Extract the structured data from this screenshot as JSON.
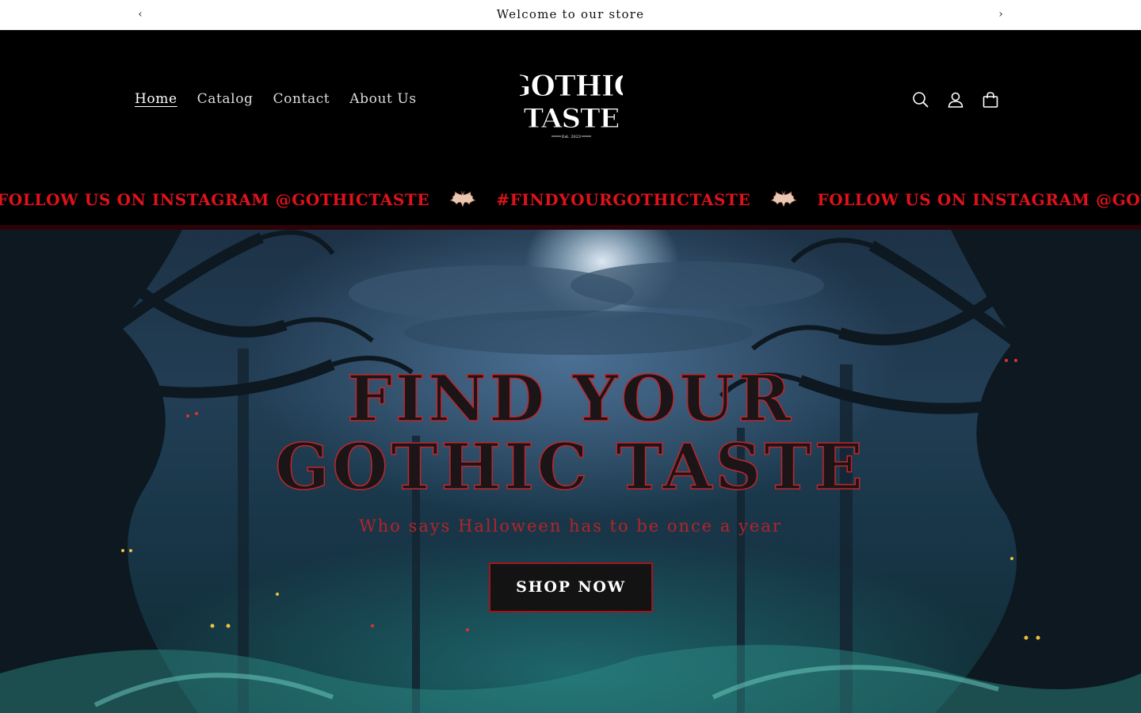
{
  "announcement": {
    "message": "Welcome to our store",
    "prev_icon": "chevron-left-icon",
    "next_icon": "chevron-right-icon"
  },
  "header": {
    "nav": [
      {
        "label": "Home",
        "active": true
      },
      {
        "label": "Catalog",
        "active": false
      },
      {
        "label": "Contact",
        "active": false
      },
      {
        "label": "About Us",
        "active": false
      }
    ],
    "logo": {
      "line1": "GOTHIC",
      "line2": "TASTE",
      "tagline": "Est. 2023"
    },
    "icons": [
      "search-icon",
      "account-icon",
      "cart-icon"
    ]
  },
  "marquee": {
    "items": [
      "FOLLOW US ON INSTAGRAM @GOTHICTASTE",
      "#FINDYOURGOTHICTASTE",
      "FOLLOW US ON INSTAGRAM @GOTHICTASTE"
    ],
    "separator_icon": "bat-icon",
    "color": "#e0121b"
  },
  "hero": {
    "title_line1": "FIND YOUR",
    "title_line2": "GOTHIC TASTE",
    "subtitle": "Who says Halloween has to be once a year",
    "button_label": "SHOP NOW",
    "accent": "#c0262e"
  }
}
